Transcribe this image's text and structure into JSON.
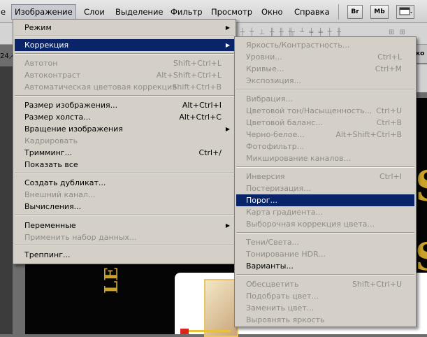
{
  "menubar": {
    "items": [
      {
        "label": "е",
        "x": 0
      },
      {
        "label": "Изображение",
        "active": true
      },
      {
        "label": "Слои"
      },
      {
        "label": "Выделение"
      },
      {
        "label": "Фильтр"
      },
      {
        "label": "Просмотр"
      },
      {
        "label": "Окно"
      },
      {
        "label": "Справка"
      }
    ],
    "icons": [
      {
        "name": "bridge-icon",
        "label": "Br"
      },
      {
        "name": "mini-bridge-icon",
        "label": "Mb"
      },
      {
        "name": "screen-mode-icon",
        "label": ""
      }
    ]
  },
  "background": {
    "options_glyphs": "|||‖ ||| ‖| |||| ‖‖",
    "left_value": "24,4",
    "tab_fragment": "ко",
    "canvas_letters": [
      "S",
      "S",
      "LE"
    ]
  },
  "main_menu": {
    "items": [
      {
        "label": "Режим",
        "submenu": true
      },
      {
        "label": "Коррекция",
        "submenu": true,
        "highlight": true
      },
      {
        "label": "Автотон",
        "shortcut": "Shift+Ctrl+L",
        "disabled": true
      },
      {
        "label": "Автоконтраст",
        "shortcut": "Alt+Shift+Ctrl+L",
        "disabled": true
      },
      {
        "label": "Автоматическая цветовая коррекция",
        "shortcut": "Shift+Ctrl+B",
        "disabled": true
      },
      {
        "label": "Размер изображения...",
        "shortcut": "Alt+Ctrl+I"
      },
      {
        "label": "Размер холста...",
        "shortcut": "Alt+Ctrl+C"
      },
      {
        "label": "Вращение изображения",
        "submenu": true
      },
      {
        "label": "Кадрировать",
        "disabled": true
      },
      {
        "label": "Тримминг...",
        "shortcut": "Ctrl+/"
      },
      {
        "label": "Показать все"
      },
      {
        "label": "Создать дубликат..."
      },
      {
        "label": "Внешний канал...",
        "disabled": true
      },
      {
        "label": "Вычисления..."
      },
      {
        "label": "Переменные",
        "submenu": true
      },
      {
        "label": "Применить набор данных...",
        "disabled": true
      },
      {
        "label": "Треппинг..."
      }
    ]
  },
  "sub_menu": {
    "items": [
      {
        "label": "Яркость/Контрастность...",
        "disabled": true
      },
      {
        "label": "Уровни...",
        "shortcut": "Ctrl+L",
        "disabled": true
      },
      {
        "label": "Кривые...",
        "shortcut": "Ctrl+M",
        "disabled": true
      },
      {
        "label": "Экспозиция...",
        "disabled": true
      },
      {
        "label": "Вибрация...",
        "disabled": true
      },
      {
        "label": "Цветовой тон/Насыщенность...",
        "shortcut": "Ctrl+U",
        "disabled": true
      },
      {
        "label": "Цветовой баланс...",
        "shortcut": "Ctrl+B",
        "disabled": true
      },
      {
        "label": "Черно-белое...",
        "shortcut": "Alt+Shift+Ctrl+B",
        "disabled": true
      },
      {
        "label": "Фотофильтр...",
        "disabled": true
      },
      {
        "label": "Микширование каналов...",
        "disabled": true
      },
      {
        "label": "Инверсия",
        "shortcut": "Ctrl+I",
        "disabled": true
      },
      {
        "label": "Постеризация...",
        "disabled": true
      },
      {
        "label": "Порог...",
        "highlight": true
      },
      {
        "label": "Карта градиента...",
        "disabled": true
      },
      {
        "label": "Выборочная коррекция цвета...",
        "disabled": true
      },
      {
        "label": "Тени/Света...",
        "disabled": true
      },
      {
        "label": "Тонирование HDR...",
        "disabled": true
      },
      {
        "label": "Варианты..."
      },
      {
        "label": "Обесцветить",
        "shortcut": "Shift+Ctrl+U",
        "disabled": true
      },
      {
        "label": "Подобрать цвет...",
        "disabled": true
      },
      {
        "label": "Заменить цвет...",
        "disabled": true
      },
      {
        "label": "Выровнять яркость",
        "disabled": true
      }
    ]
  },
  "colors": {
    "highlight": "#0a246a",
    "menu_bg": "#d4d0c8",
    "disabled_text": "#8e8c86",
    "gold": "#c9a227"
  }
}
